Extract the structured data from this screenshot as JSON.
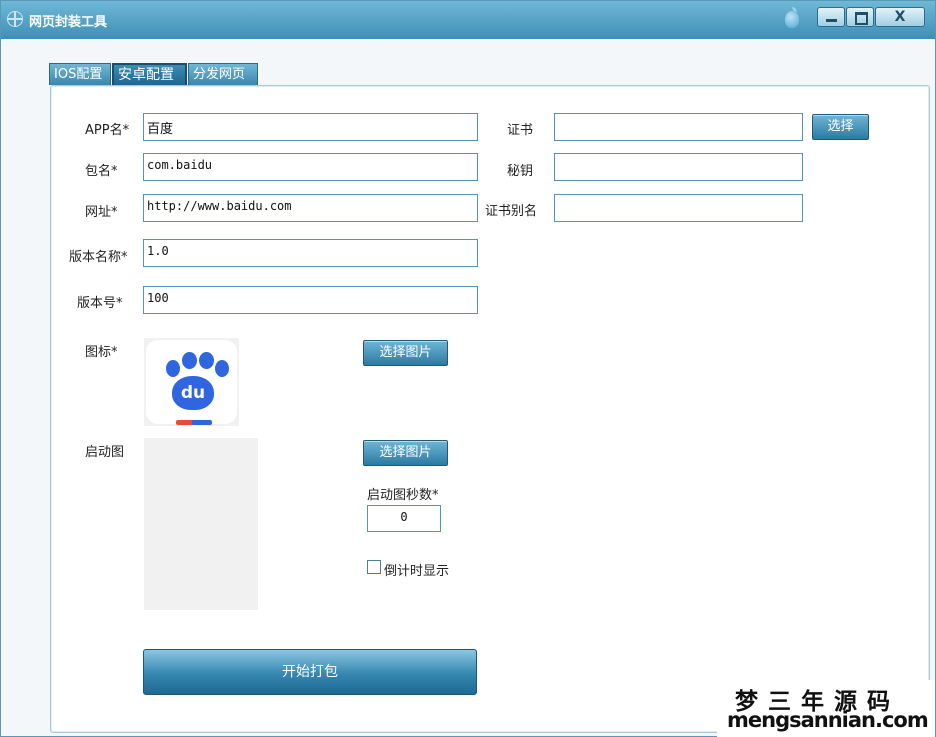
{
  "window": {
    "title": "网页封装工具",
    "close_label": "X"
  },
  "tabs": [
    {
      "label": "IOS配置"
    },
    {
      "label": "安卓配置"
    },
    {
      "label": "分发网页"
    }
  ],
  "form": {
    "app_name": {
      "label": "APP名*",
      "value": "百度"
    },
    "package": {
      "label": "包名*",
      "value": "com.baidu"
    },
    "url": {
      "label": "网址*",
      "value": "http://www.baidu.com"
    },
    "version_name": {
      "label": "版本名称*",
      "value": "1.0"
    },
    "version_code": {
      "label": "版本号*",
      "value": "100"
    },
    "icon": {
      "label": "图标*",
      "button": "选择图片",
      "icon_text": "du"
    },
    "splash": {
      "label": "启动图",
      "button": "选择图片"
    },
    "splash_seconds": {
      "label": "启动图秒数*",
      "value": "0"
    },
    "countdown": {
      "label": "倒计时显示",
      "checked": false
    },
    "certificate": {
      "label": "证书",
      "value": "",
      "button": "选择"
    },
    "secret": {
      "label": "秘钥",
      "value": ""
    },
    "alias": {
      "label": "证书别名",
      "value": ""
    },
    "build_button": "开始打包"
  },
  "watermark": {
    "cn": "梦三年源码",
    "en": "mengsannian.com"
  },
  "colors": {
    "accent": "#3a86ad",
    "baidu_blue": "#2f66e0",
    "baidu_red": "#e84a3a"
  }
}
